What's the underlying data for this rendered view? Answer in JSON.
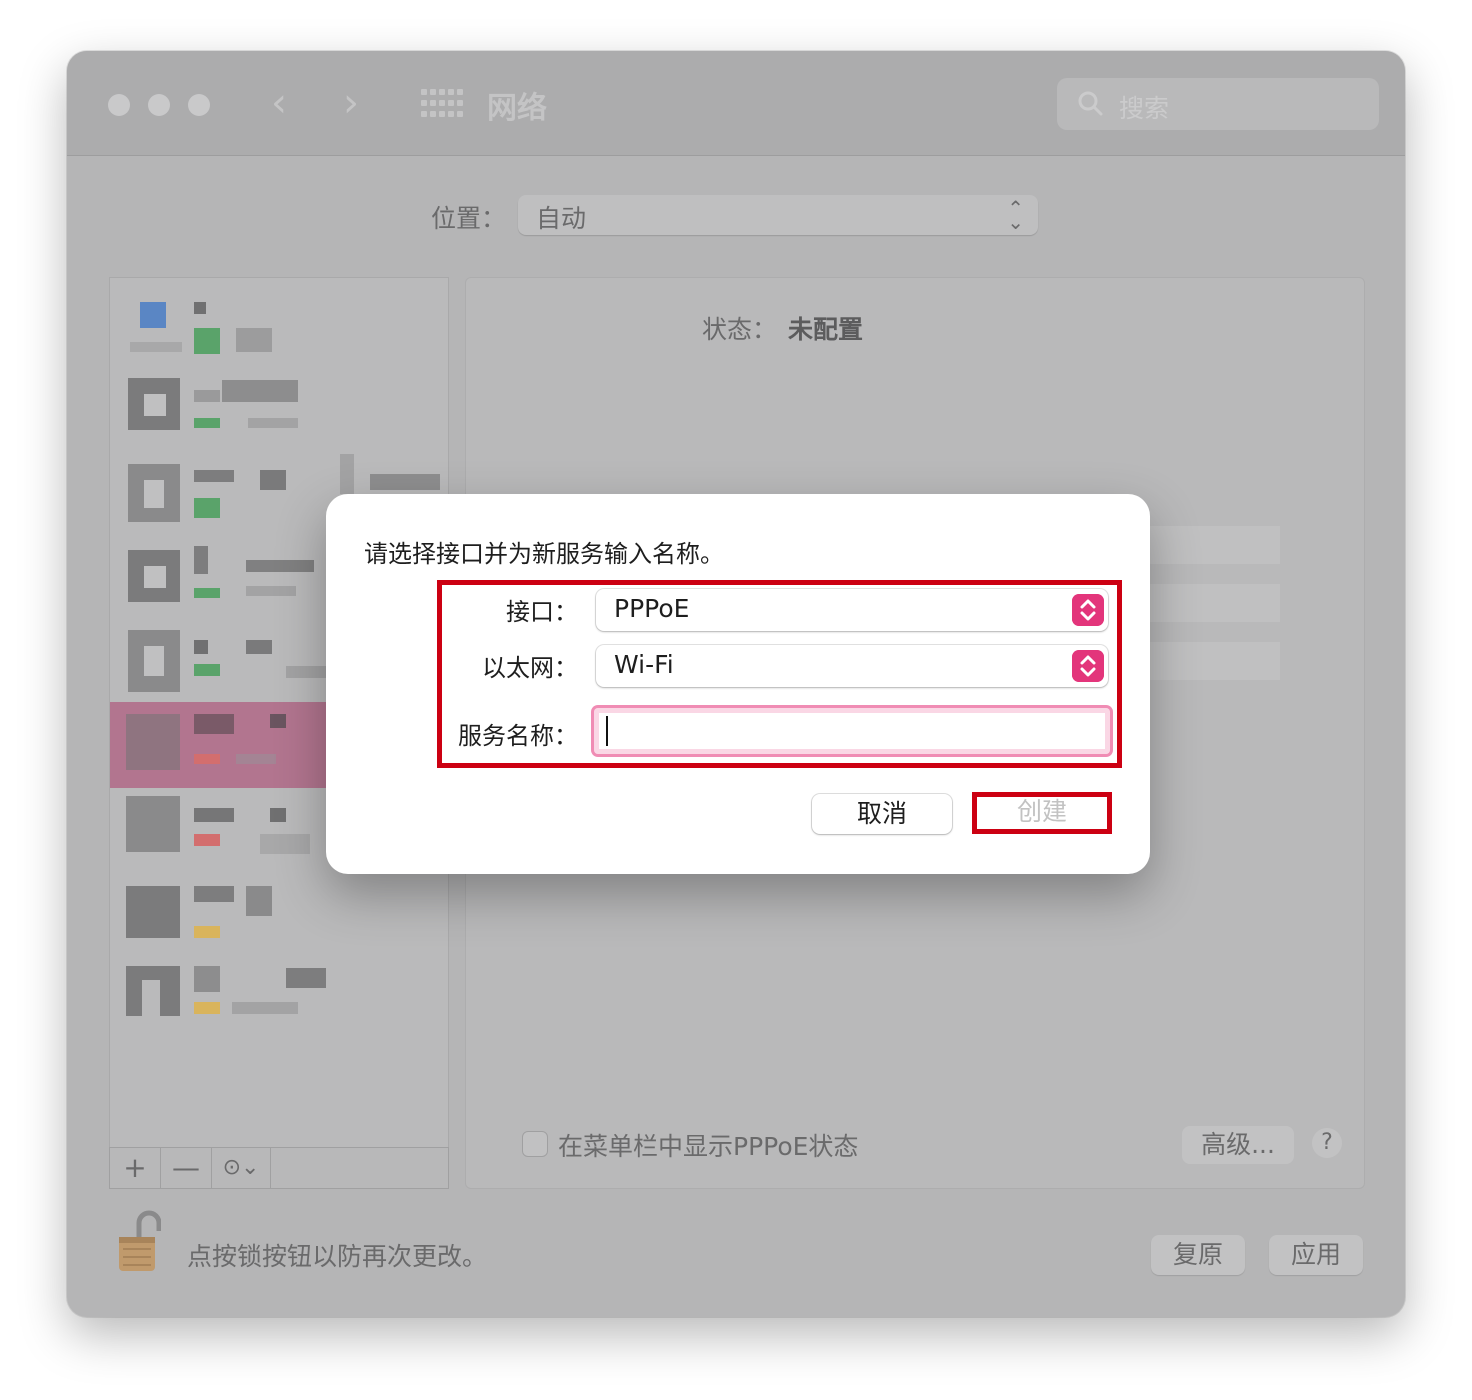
{
  "window": {
    "title": "网络",
    "search_placeholder": "搜索",
    "nav_back": "‹",
    "nav_forward": "›"
  },
  "location": {
    "label": "位置：",
    "value": "自动"
  },
  "status": {
    "label": "状态：",
    "value": "未配置"
  },
  "sidebar_toolbar": {
    "add": "+",
    "remove": "—",
    "actions": "⊙⌄"
  },
  "panel": {
    "show_status_checkbox_label": "在菜单栏中显示PPPoE状态",
    "advanced_button": "高级...",
    "help_button": "?"
  },
  "footer": {
    "lock_text": "点按锁按钮以防再次更改。",
    "revert_button": "复原",
    "apply_button": "应用"
  },
  "sheet": {
    "message": "请选择接口并为新服务输入名称。",
    "interface_label": "接口：",
    "interface_value": "PPPoE",
    "ethernet_label": "以太网：",
    "ethernet_value": "Wi-Fi",
    "service_name_label": "服务名称：",
    "service_name_value": "",
    "cancel_button": "取消",
    "create_button": "创建"
  },
  "colors": {
    "accent": "#e3357b",
    "highlight_annotation": "#cc0012",
    "selected_row": "#b2758f"
  },
  "icons": [
    "search-icon",
    "grid-icon",
    "chevron-updown-icon",
    "lock-icon",
    "plus-icon",
    "minus-icon",
    "ellipsis-circle-icon"
  ]
}
